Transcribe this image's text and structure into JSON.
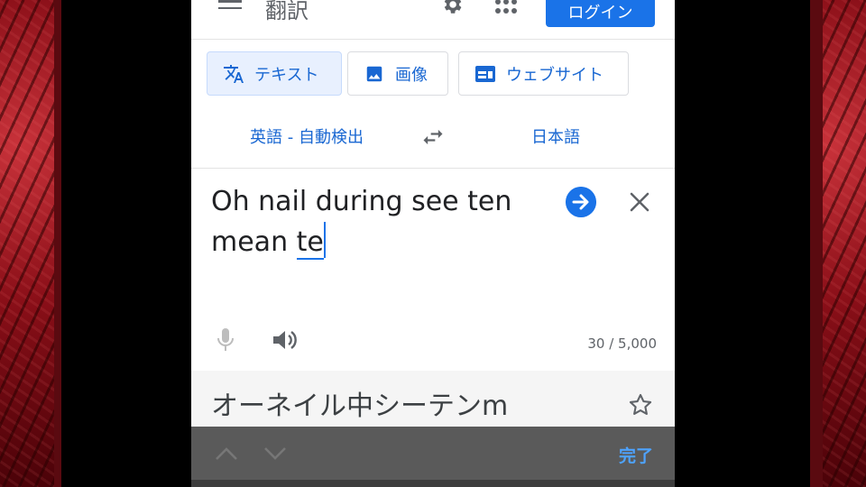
{
  "header": {
    "title": "翻訳",
    "login_label": "ログイン"
  },
  "modes": [
    {
      "label": "テキスト",
      "icon": "translate-icon",
      "active": true
    },
    {
      "label": "画像",
      "icon": "image-icon",
      "active": false
    },
    {
      "label": "ウェブサイト",
      "icon": "website-icon",
      "active": false
    }
  ],
  "languages": {
    "source": "英語 - 自動検出",
    "target": "日本語"
  },
  "input": {
    "line1": "Oh nail during see ten",
    "line2_prefix": "mean ",
    "line2_active_word": "te",
    "char_count": "30 / 5,000"
  },
  "output": {
    "text": "オーネイル中シーテンm"
  },
  "keyboard_bar": {
    "done_label": "完了"
  },
  "colors": {
    "accent": "#1a73e8",
    "link": "#1967d2",
    "side_panel": "#8a0f18"
  }
}
